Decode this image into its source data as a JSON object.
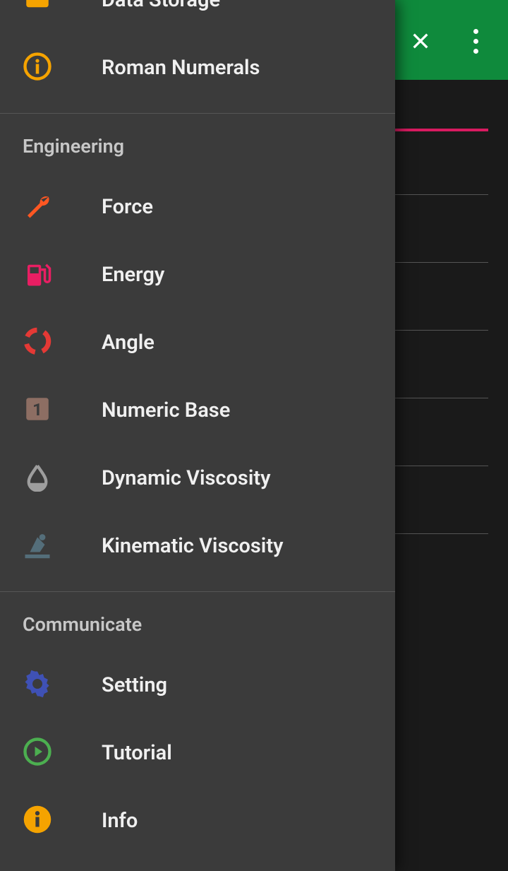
{
  "drawer": {
    "top_items": [
      {
        "label": "Data Storage",
        "icon": "storage-icon",
        "color": "#f5a300"
      },
      {
        "label": "Roman Numerals",
        "icon": "info-circle-icon",
        "color": "#f5a300"
      }
    ],
    "sections": [
      {
        "title": "Engineering",
        "items": [
          {
            "label": "Force",
            "icon": "wrench-icon",
            "color": "#ff5722"
          },
          {
            "label": "Energy",
            "icon": "fuel-icon",
            "color": "#e91e63"
          },
          {
            "label": "Angle",
            "icon": "angle-icon",
            "color": "#e53935"
          },
          {
            "label": "Numeric Base",
            "icon": "numeric-base-icon",
            "color": "#8d6e63"
          },
          {
            "label": "Dynamic Viscosity",
            "icon": "droplet-icon",
            "color": "#9e9e9e"
          },
          {
            "label": "Kinematic Viscosity",
            "icon": "viscosity-icon",
            "color": "#546e7a"
          }
        ]
      },
      {
        "title": "Communicate",
        "items": [
          {
            "label": "Setting",
            "icon": "gear-icon",
            "color": "#3f51b5"
          },
          {
            "label": "Tutorial",
            "icon": "play-circle-icon",
            "color": "#4caf50"
          },
          {
            "label": "Info",
            "icon": "info-filled-icon",
            "color": "#f5a300"
          }
        ]
      }
    ]
  },
  "background": {
    "accent": "#0f8a3c",
    "active_underline": "#d81b60"
  }
}
